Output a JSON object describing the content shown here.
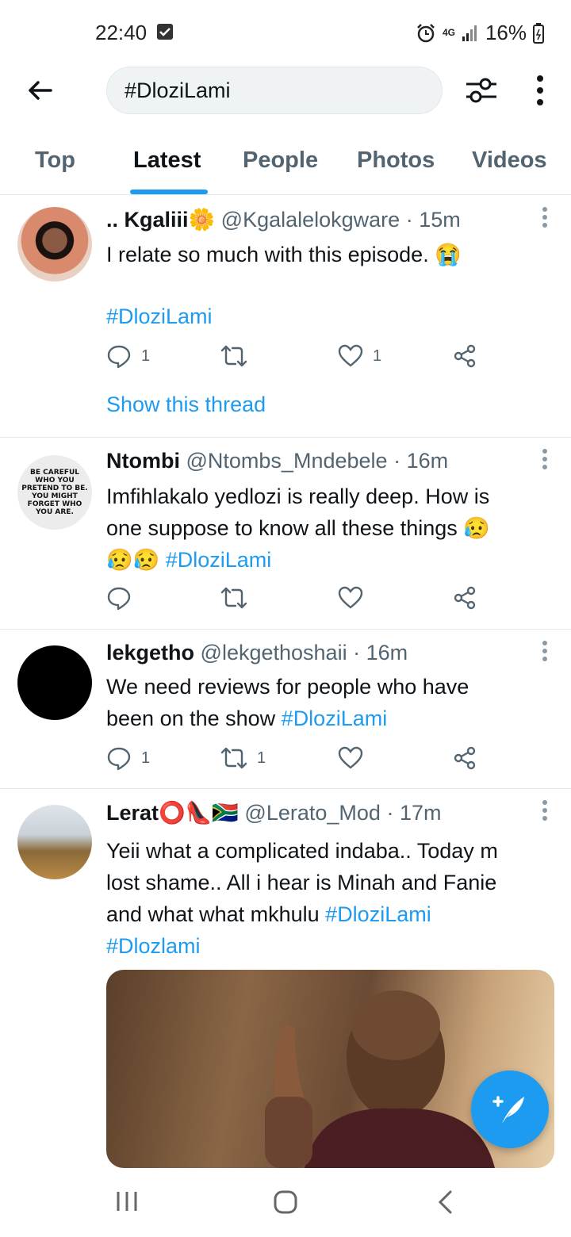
{
  "status_bar": {
    "time": "22:40",
    "network": "4G",
    "battery": "16%"
  },
  "search": {
    "query": "#DloziLami"
  },
  "tabs": [
    {
      "label": "Top",
      "active": false
    },
    {
      "label": "Latest",
      "active": true
    },
    {
      "label": "People",
      "active": false
    },
    {
      "label": "Photos",
      "active": false
    },
    {
      "label": "Videos",
      "active": false
    }
  ],
  "tweets": [
    {
      "name": ".. Kgaliii🌼",
      "handle": "@Kgalalelokgware",
      "time": "15m",
      "text": "I relate so much with this episode. 😭",
      "hashtag": "#DloziLami",
      "replies": "1",
      "retweets": "",
      "likes": "1",
      "show_thread": "Show this thread"
    },
    {
      "name": "Ntombi",
      "handle": "@Ntombs_Mndebele",
      "time": "16m",
      "text_lines": [
        "Imfihlakalo yedlozi is really deep. How is",
        "one suppose to know all these things 😥",
        "😥😥 "
      ],
      "hashtag": "#DloziLami",
      "avatar_text": [
        "BE CAREFUL",
        "WHO YOU",
        "PRETEND TO BE.",
        "YOU MIGHT",
        "FORGET WHO",
        "YOU ARE."
      ],
      "replies": "",
      "retweets": "",
      "likes": ""
    },
    {
      "name": "lekgetho",
      "handle": "@lekgethoshaii",
      "time": "16m",
      "text_lines": [
        "We need reviews for people who have",
        "been on the show "
      ],
      "hashtag": "#DloziLami",
      "replies": "1",
      "retweets": "1",
      "likes": ""
    },
    {
      "name": "Lerat⭕👠🇿🇦",
      "handle": "@Lerato_Mod",
      "time": "17m",
      "text_lines": [
        "Yeii what a complicated indaba.. Today m",
        "lost shame.. All i hear is Minah and Fanie",
        "and what what mkhulu "
      ],
      "hashtag": "#DloziLami",
      "hashtag2": "#Dlozlami"
    }
  ],
  "colors": {
    "accent": "#1d9bf0",
    "text_primary": "#0f1419",
    "text_secondary": "#536471",
    "divider": "#e6e9eb"
  },
  "icons": [
    "back-arrow-icon",
    "filter-icon",
    "more-vertical-icon",
    "reply-icon",
    "retweet-icon",
    "like-icon",
    "share-icon",
    "compose-icon",
    "recents-icon",
    "home-icon",
    "back-nav-icon"
  ]
}
